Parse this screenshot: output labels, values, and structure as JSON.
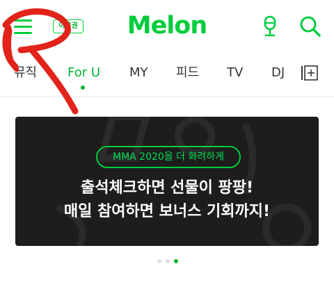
{
  "header": {
    "ticket_label": "이용권",
    "logo_text": "Melon"
  },
  "tabs": [
    {
      "label": "뮤직"
    },
    {
      "label": "For U"
    },
    {
      "label": "MY"
    },
    {
      "label": "피드"
    },
    {
      "label": "TV"
    },
    {
      "label": "DJ"
    }
  ],
  "banner": {
    "pill_text": "MMA 2020을 더 화려하게",
    "line1": "출석체크하면 선물이 팡팡!",
    "line2": "매일 참여하면 보너스 기회까지!"
  },
  "pager": {
    "count": 3,
    "active_index": 2
  },
  "colors": {
    "brand": "#00cd3c",
    "banner_bg": "#1d1d1d",
    "scribble": "#e2231a"
  }
}
